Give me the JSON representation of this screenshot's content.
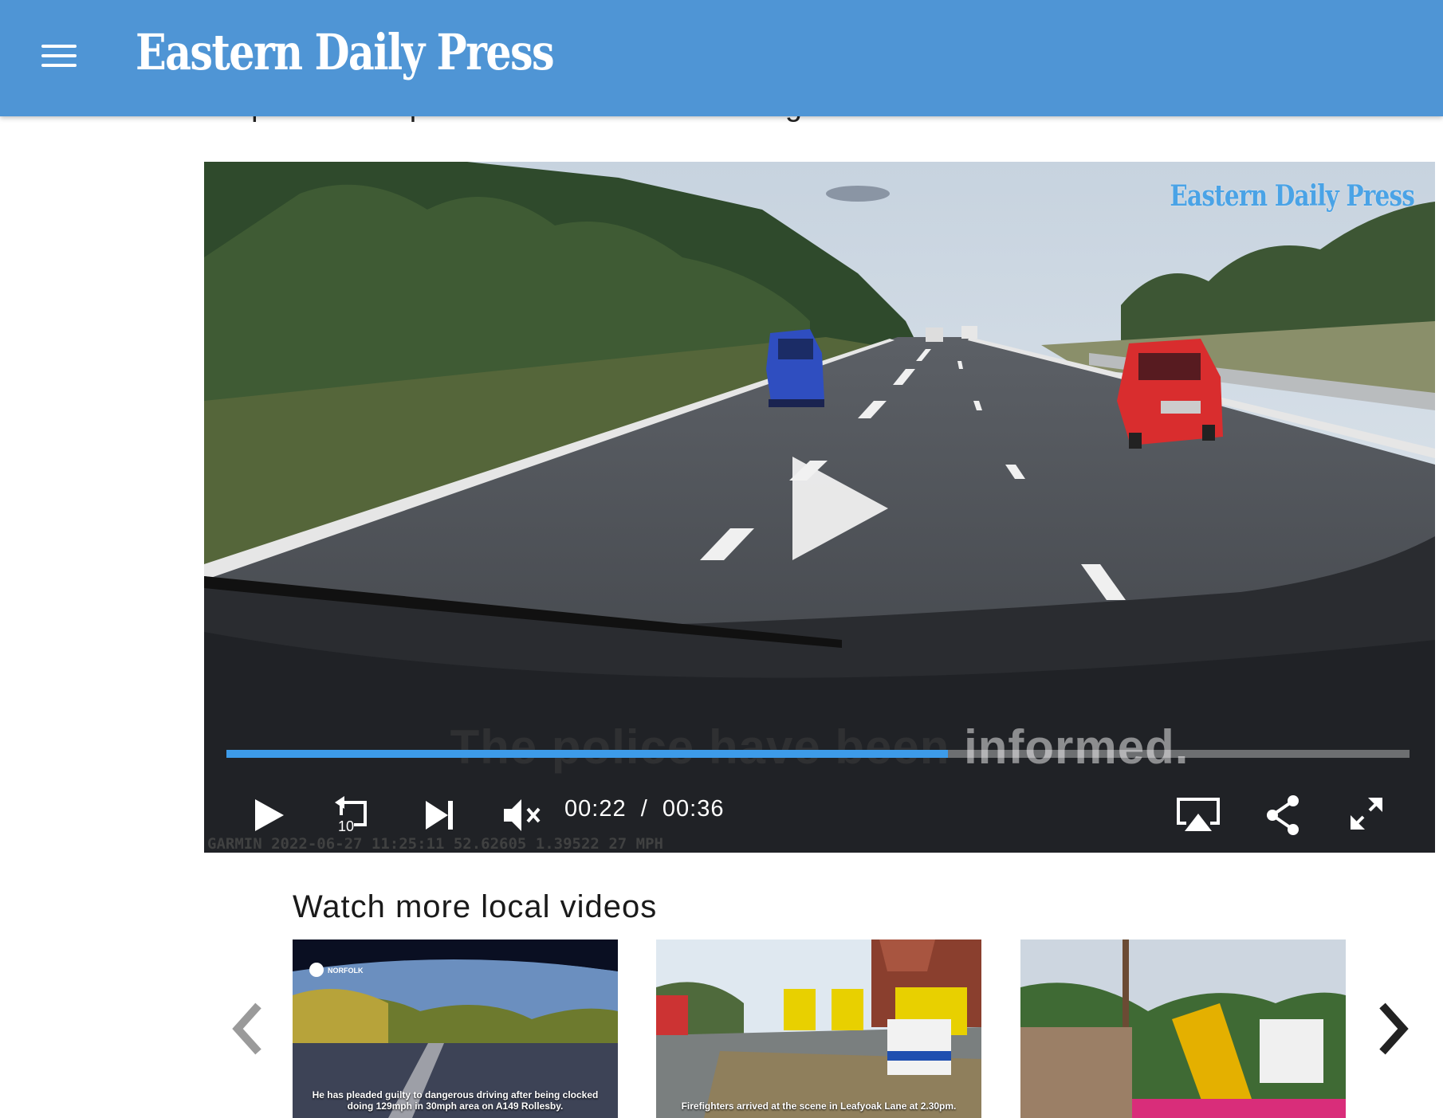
{
  "header": {
    "title": "Eastern Daily Press",
    "menu_icon": "hamburger-menu-icon",
    "background_color": "#4f95d5"
  },
  "article": {
    "partial_text": "his phone to capture the animal in the footage."
  },
  "video": {
    "watermark": "Eastern Daily Press",
    "subtitle_left": "The police have been",
    "subtitle_right": " informed.",
    "current_time": "00:22",
    "separator": "/",
    "duration": "00:36",
    "progress": 0.61,
    "accent_color": "#3d9be9",
    "dashcam_text": "GARMIN 2022-06-27 11:25:11 52.62605 1.39522 27 MPH",
    "controls": [
      "play-icon",
      "rewind-10-icon",
      "next-icon",
      "mute-icon",
      "airplay-icon",
      "share-icon",
      "fullscreen-icon"
    ]
  },
  "related": {
    "heading": "Watch more local videos",
    "prev_icon": "chevron-left-icon",
    "next_icon": "chevron-right-icon",
    "items": [
      {
        "caption": "He has pleaded guilty to dangerous driving after being clocked doing 129mph in 30mph area on A149 Rollesby.",
        "badge": "NORFOLK"
      },
      {
        "caption": "Firefighters arrived at the scene in Leafyoak Lane at 2.30pm."
      },
      {
        "caption": ""
      }
    ]
  }
}
